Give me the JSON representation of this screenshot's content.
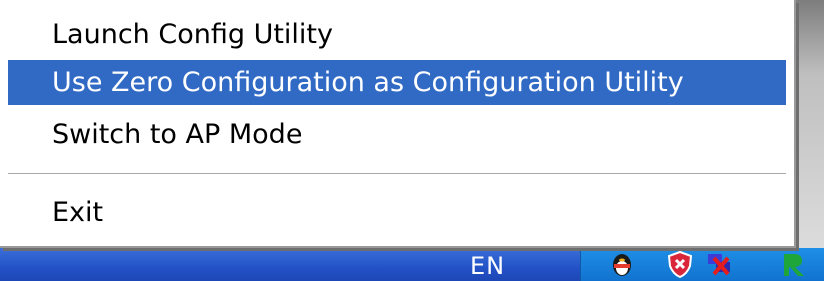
{
  "menu": {
    "items": [
      {
        "label": "Launch Config Utility",
        "highlighted": false
      },
      {
        "label": "Use Zero Configuration as Configuration Utility",
        "highlighted": true
      },
      {
        "label": "Switch to AP Mode",
        "highlighted": false
      },
      {
        "label": "Exit",
        "highlighted": false
      }
    ],
    "highlight_color": "#316ac5"
  },
  "taskbar": {
    "language": "EN",
    "tray_icons": [
      "qq-penguin-icon",
      "security-shield-icon",
      "network-disconnected-icon",
      "realtek-icon"
    ]
  }
}
